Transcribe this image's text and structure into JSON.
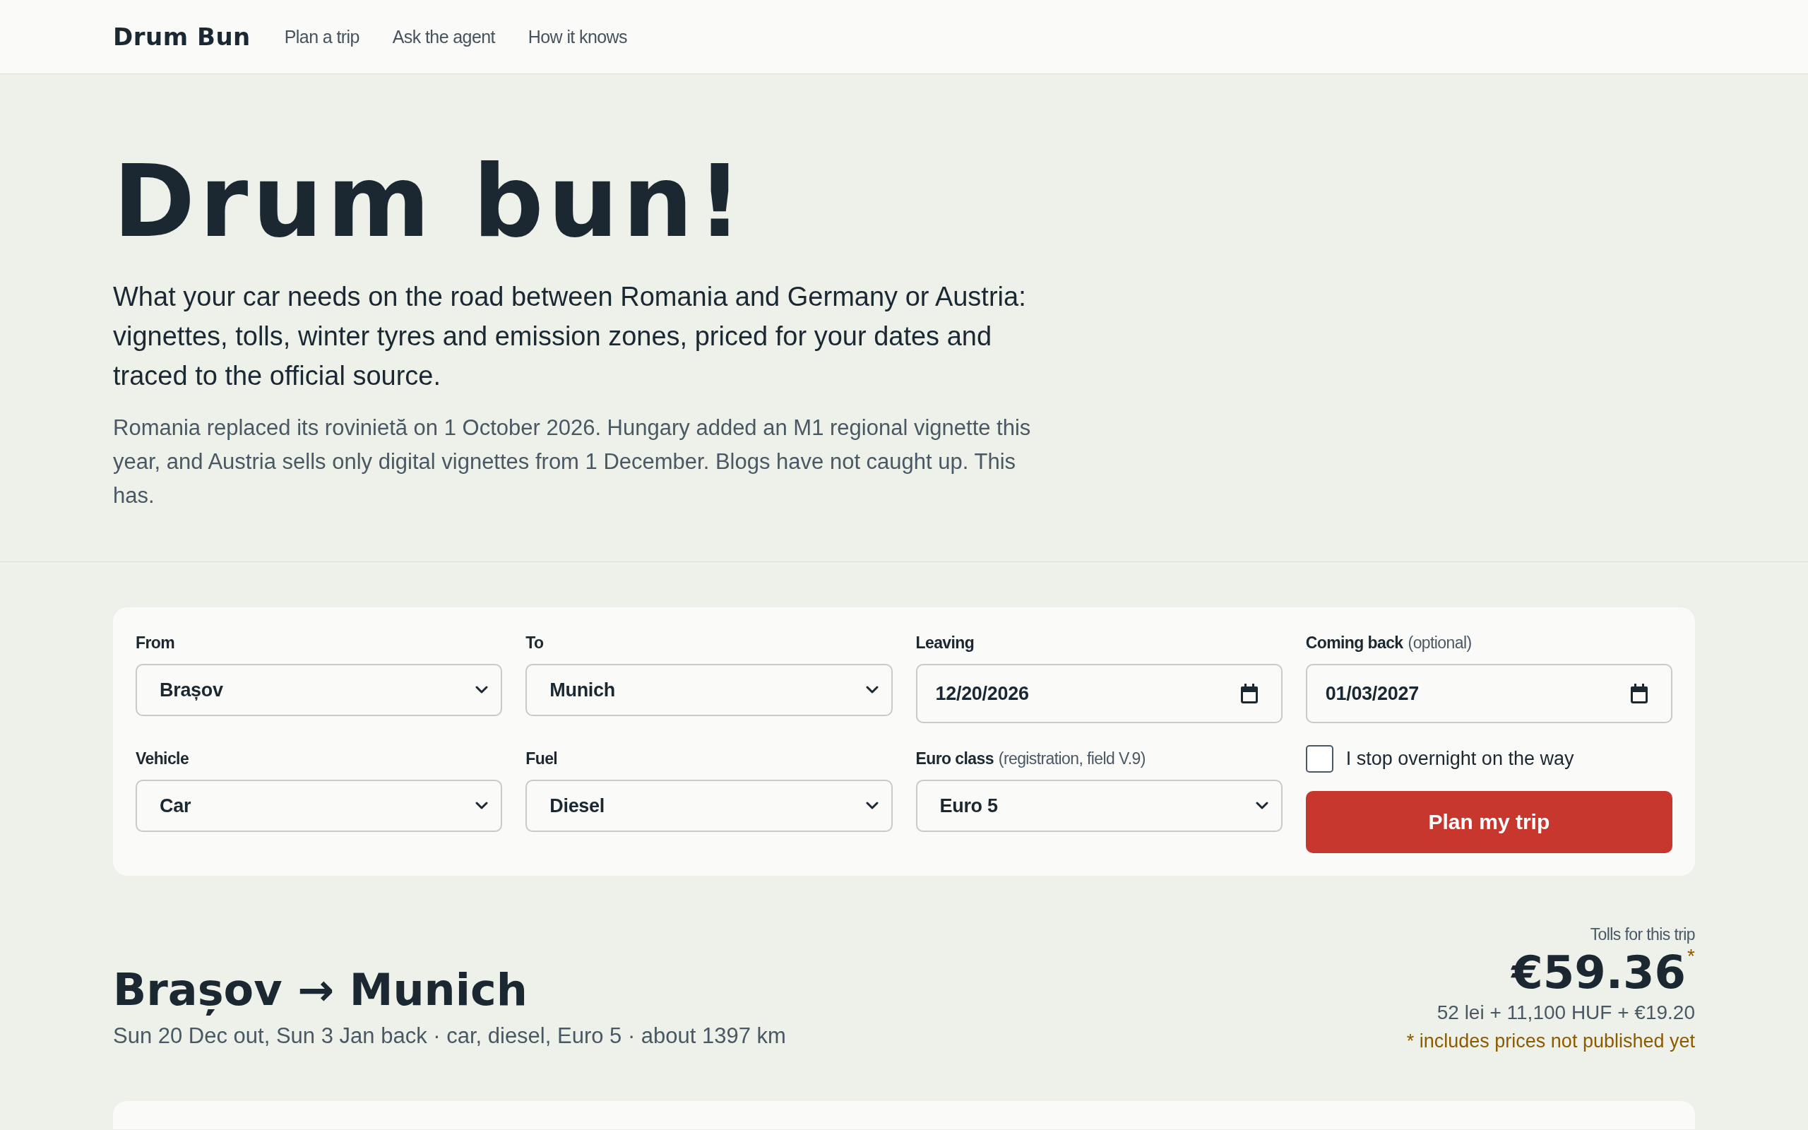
{
  "header": {
    "logo": "Drum Bun",
    "nav": [
      "Plan a trip",
      "Ask the agent",
      "How it knows"
    ]
  },
  "hero": {
    "title": "Drum bun!",
    "lead": "What your car needs on the road between Romania and Germany or Austria: vignettes, tolls, winter tyres and emission zones, priced for your dates and traced to the official source.",
    "note": "Romania replaced its rovinietă on 1 October 2026. Hungary added an M1 regional vignette this year, and Austria sells only digital vignettes from 1 December. Blogs have not caught up. This has."
  },
  "form": {
    "fields": [
      {
        "kind": "select",
        "label": "From",
        "value": "Brașov"
      },
      {
        "kind": "select",
        "label": "To",
        "value": "Munich"
      },
      {
        "kind": "date",
        "label": "Leaving",
        "value": "12/20/2026"
      },
      {
        "kind": "date",
        "label": "Coming back",
        "hint": "(optional)",
        "value": "01/03/2027"
      },
      {
        "kind": "select",
        "label": "Vehicle",
        "value": "Car"
      },
      {
        "kind": "select",
        "label": "Fuel",
        "value": "Diesel"
      },
      {
        "kind": "select",
        "label": "Euro class",
        "hint": "(registration, field V.9)",
        "value": "Euro 5"
      }
    ],
    "overnight": {
      "label": "I stop overnight on the way",
      "checked": false
    },
    "submit": "Plan my trip"
  },
  "trip": {
    "title": "Brașov → Munich",
    "summary": "Sun 20 Dec out, Sun 3 Jan back · car, diesel, Euro 5 · about 1397 km",
    "tolls_label": "Tolls for this trip",
    "total": "€59.36$^{*}$",
    "breakdown": "52 lei + 11,100 HUF + €19.20",
    "footnote": "* includes prices not published yet"
  }
}
